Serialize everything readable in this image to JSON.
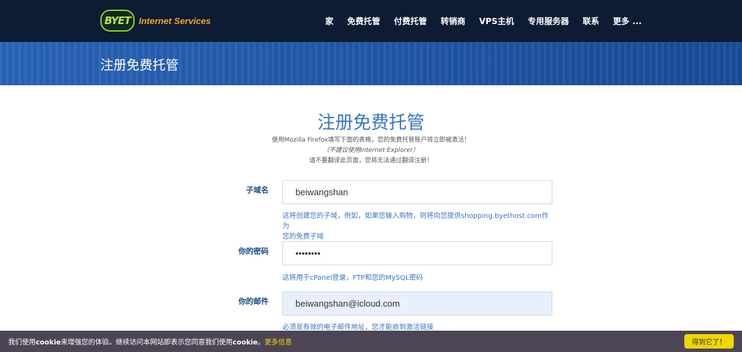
{
  "brand": {
    "logo_text": "BYET",
    "tagline": "Internet Services"
  },
  "nav": {
    "items": [
      {
        "label": "家"
      },
      {
        "label": "免费托管"
      },
      {
        "label": "付费托管"
      },
      {
        "label": "转销商"
      },
      {
        "label": "VPS主机"
      },
      {
        "label": "专用服务器"
      },
      {
        "label": "联系"
      },
      {
        "label": "更多 ..."
      }
    ]
  },
  "banner": {
    "title": "注册免费托管"
  },
  "form": {
    "heading": "注册免费托管",
    "note1": "使用Mozilla Firefox填写下面的表格，您的免费托管账户将立即被激活！",
    "note2": "（不建议使用Internet Explorer）",
    "note3": "请不要翻译此页面，您将无法通过翻译注册！",
    "subdomain": {
      "label": "子域名",
      "value": "beiwangshan",
      "hint_line1": "这将创建您的子域，例如，如果您输入购物，则将向您提供shopping.byethost.com作为",
      "hint_line2": "您的免费子域"
    },
    "password": {
      "label": "你的密码",
      "value": "••••••••",
      "hint": "这将用于cPanel登录，FTP和您的MySQL密码"
    },
    "email": {
      "label": "你的邮件",
      "value": "beiwangshan@icloud.com",
      "hint": "必须是有效的电子邮件地址，您才能收到激活链接"
    }
  },
  "cookie": {
    "text_prefix": "我们使用",
    "text_cookie1": "cookie",
    "text_mid": "来增强您的体验。继续访问本网站即表示您同意我们使用",
    "text_cookie2": "cookie",
    "text_end": "。",
    "more_link": "更多信息",
    "accept_button": "得到它了！"
  }
}
